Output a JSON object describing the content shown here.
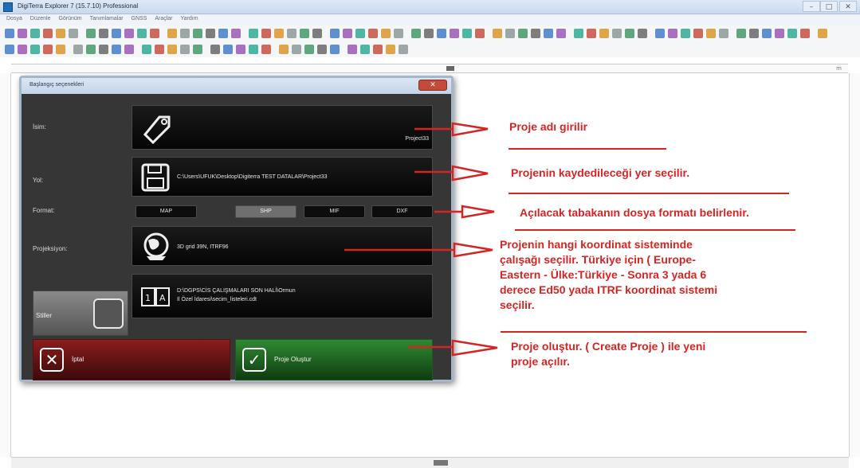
{
  "window": {
    "title": "DigiTerra Explorer 7 (15.7.10) Professional",
    "controls": [
      "–",
      "□",
      "✕"
    ]
  },
  "menu": [
    "Dosya",
    "Düzenle",
    "Görünüm",
    "Tanımlamalar",
    "GNSS",
    "Araçlar",
    "Yardım"
  ],
  "ruler": {
    "right_label": "m"
  },
  "dialog": {
    "title": "Başlangıç seçenekleri",
    "close": "✕",
    "name_label": "İsim:",
    "name_value": "Project33",
    "path_label": "Yol:",
    "path_value": "C:\\Users\\UFUK\\Desktop\\Digiterra TEST DATALAR\\Project33",
    "format_label": "Format:",
    "formats": [
      "MAP",
      "SHP",
      "MIF",
      "DXF"
    ],
    "selected_format": "SHP",
    "projection_label": "Projeksiyon:",
    "projection_value": "3D grid 39N, ITRF96",
    "style_label": "Stiller",
    "style_path_line1": "D:\\DGPS\\CİS ÇALIŞMALARI SON HALİ\\Ormun",
    "style_path_line2": "Il Özel İdaresi\\secim_listeleri.cdt",
    "cancel_label": "İptal",
    "create_label": "Proje Oluştur"
  },
  "annotations": {
    "name": "Proje adı girilir",
    "path": "Projenin kaydedileceği yer seçilir.",
    "format": "Açılacak tabakanın dosya formatı belirlenir.",
    "projection_1": "Projenin hangi koordinat sisteminde",
    "projection_2": "çalışağı seçilir. Türkiye için ( Europe-",
    "projection_3": "Eastern - Ülke:Türkiye - Sonra 3 yada 6",
    "projection_4": "derece Ed50 yada ITRF koordinat sistemi",
    "projection_5": "seçilir.",
    "create_1": "Proje oluştur. ( Create Proje ) ile yeni",
    "create_2": "proje açılır."
  },
  "colors": {
    "annotation": "#d42525",
    "cancel": "#8c1c1c",
    "create": "#2f8a32",
    "dialog_bg": "#363636"
  }
}
